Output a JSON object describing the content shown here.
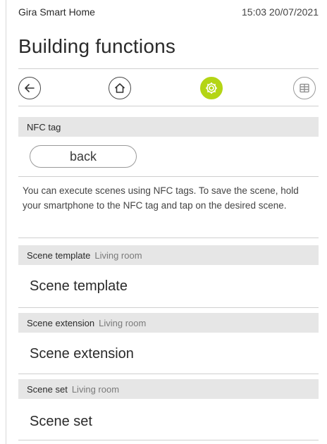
{
  "status_bar": {
    "app_name": "Gira Smart Home",
    "datetime": "15:03 20/07/2021"
  },
  "page_title": "Building functions",
  "navbar": {
    "items": [
      {
        "icon": "arrow-left-icon",
        "state": "normal"
      },
      {
        "icon": "home-icon",
        "state": "normal"
      },
      {
        "icon": "gear-icon",
        "state": "active"
      },
      {
        "icon": "grid-icon",
        "state": "dim"
      }
    ],
    "accent_color": "#b4d515"
  },
  "nfc_section": {
    "header": "NFC tag",
    "back_label": "back",
    "info_text": "You can execute scenes using NFC tags. To save the scene, hold your smartphone to the NFC tag and tap on the desired scene."
  },
  "scenes": [
    {
      "type_label": "Scene template",
      "room": "Living room",
      "name": "Scene template"
    },
    {
      "type_label": "Scene extension",
      "room": "Living room",
      "name": "Scene extension"
    },
    {
      "type_label": "Scene set",
      "room": "Living room",
      "name": "Scene set"
    }
  ]
}
